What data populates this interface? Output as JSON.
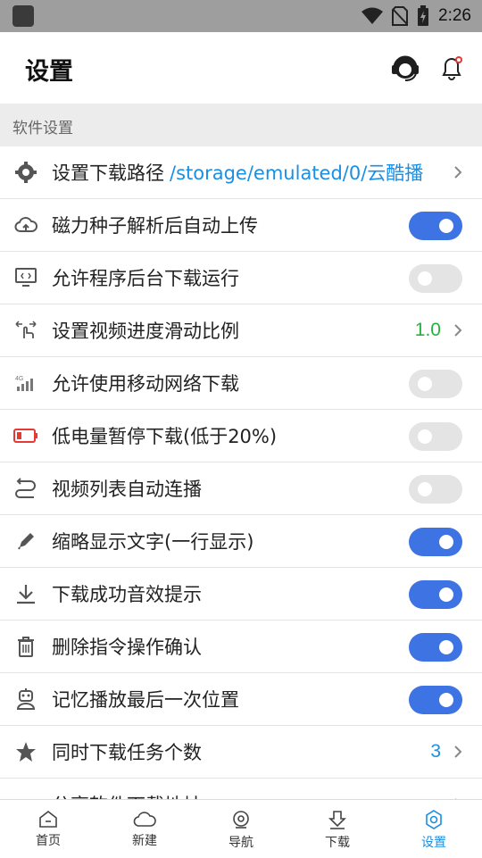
{
  "status_bar": {
    "time": "2:26"
  },
  "header": {
    "title": "设置",
    "icons": [
      "headset-icon",
      "bell-icon"
    ]
  },
  "section": {
    "label": "软件设置"
  },
  "settings": [
    {
      "label": "设置下载路径",
      "path": "/storage/emulated/0/云酷播",
      "type": "link",
      "icon": "gear-icon"
    },
    {
      "label": "磁力种子解析后自动上传",
      "type": "toggle",
      "on": true,
      "icon": "cloud-upload-icon"
    },
    {
      "label": "允许程序后台下载运行",
      "type": "toggle",
      "on": false,
      "icon": "monitor-code-icon"
    },
    {
      "label": "设置视频进度滑动比例",
      "type": "value",
      "value": "1.0",
      "icon": "swipe-hand-icon"
    },
    {
      "label": "允许使用移动网络下载",
      "type": "toggle",
      "on": false,
      "icon": "signal-4g-icon"
    },
    {
      "label": "低电量暂停下载(低于20%)",
      "type": "toggle",
      "on": false,
      "icon": "low-battery-icon"
    },
    {
      "label": "视频列表自动连播",
      "type": "toggle",
      "on": false,
      "icon": "loop-icon"
    },
    {
      "label": "缩略显示文字(一行显示)",
      "type": "toggle",
      "on": true,
      "icon": "pen-icon"
    },
    {
      "label": "下载成功音效提示",
      "type": "toggle",
      "on": true,
      "icon": "download-icon"
    },
    {
      "label": "删除指令操作确认",
      "type": "toggle",
      "on": true,
      "icon": "trash-icon"
    },
    {
      "label": "记忆播放最后一次位置",
      "type": "toggle",
      "on": true,
      "icon": "robot-icon"
    },
    {
      "label": "同时下载任务个数",
      "type": "value",
      "value": "3",
      "icon": "star-icon"
    },
    {
      "label": "分享软件下载地址",
      "type": "link",
      "icon": "share-icon"
    }
  ],
  "tabs": [
    {
      "label": "首页",
      "icon": "home-icon",
      "active": false
    },
    {
      "label": "新建",
      "icon": "cloud-icon",
      "active": false
    },
    {
      "label": "导航",
      "icon": "compass-icon",
      "active": false
    },
    {
      "label": "下载",
      "icon": "download-tab-icon",
      "active": false
    },
    {
      "label": "设置",
      "icon": "settings-tab-icon",
      "active": true
    }
  ],
  "colors": {
    "accent": "#3d73e2",
    "link": "#1a8fe3",
    "green": "#26b33d",
    "status_bar": "#9e9e9e"
  }
}
